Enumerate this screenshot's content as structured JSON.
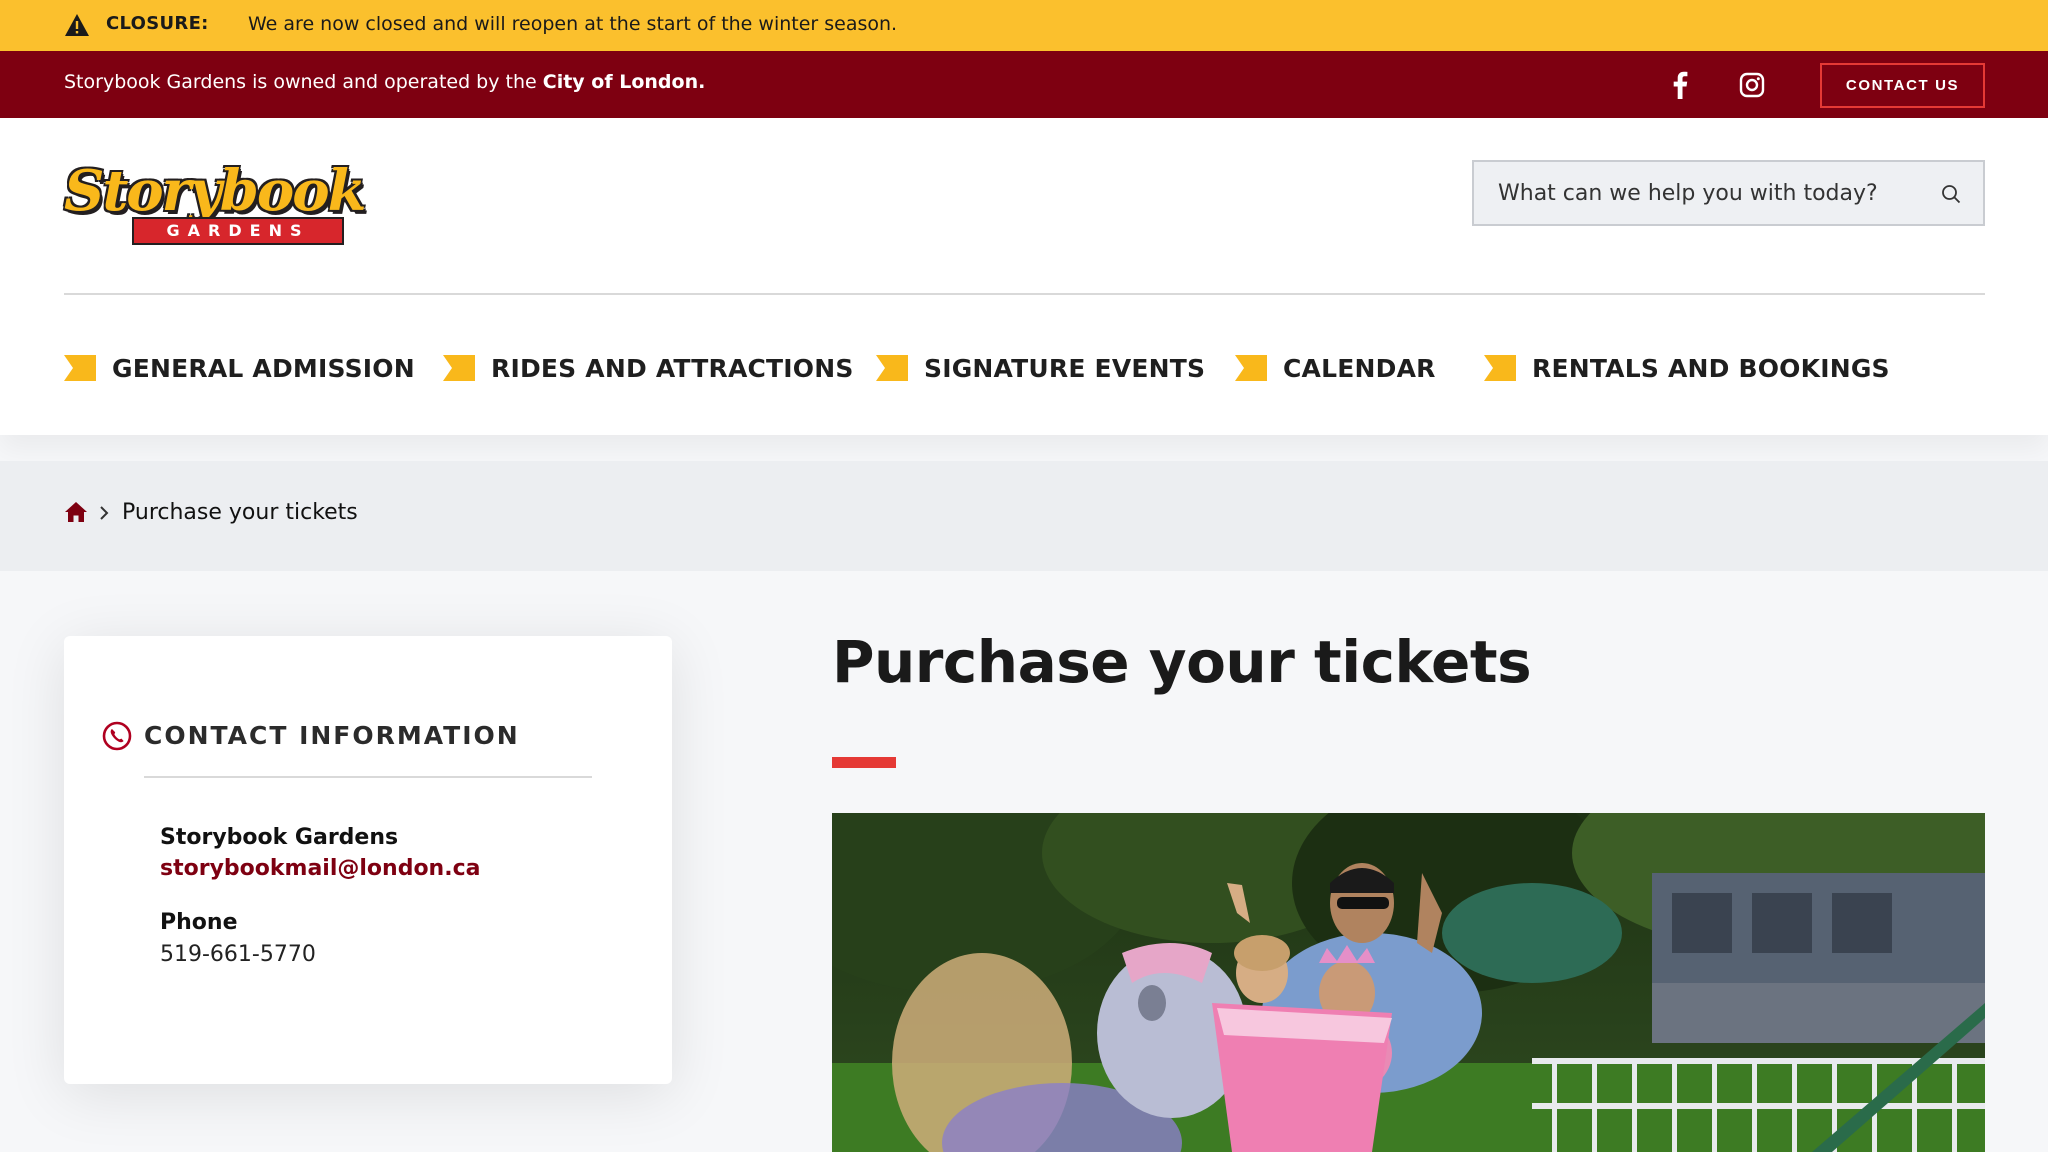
{
  "alert": {
    "label": "CLOSURE:",
    "message": "We are now closed and will reopen at the start of the winter season."
  },
  "topbar": {
    "owner_text": "Storybook Gardens is owned and operated by the",
    "owner_bold": "City of London.",
    "contact_label": "CONTACT US",
    "social": [
      "facebook-icon",
      "instagram-icon"
    ]
  },
  "logo": {
    "script": "Storybook",
    "ribbon": "GARDENS"
  },
  "search": {
    "placeholder": "What can we help you with today?"
  },
  "nav": {
    "items": [
      {
        "label": "GENERAL ADMISSION"
      },
      {
        "label": "RIDES AND ATTRACTIONS"
      },
      {
        "label": "SIGNATURE EVENTS"
      },
      {
        "label": "CALENDAR"
      },
      {
        "label": "RENTALS AND BOOKINGS"
      }
    ]
  },
  "breadcrumb": {
    "current": "Purchase your tickets"
  },
  "contact_card": {
    "heading": "CONTACT INFORMATION",
    "org_name": "Storybook Gardens",
    "email": "storybookmail@london.ca",
    "phone_label": "Phone",
    "phone_value": "519-661-5770"
  },
  "main": {
    "title": "Purchase your tickets"
  },
  "colors": {
    "alert": "#fbc02d",
    "brand_red": "#7e0011",
    "accent_red": "#e53935",
    "flag_yellow": "#f9b81b"
  }
}
